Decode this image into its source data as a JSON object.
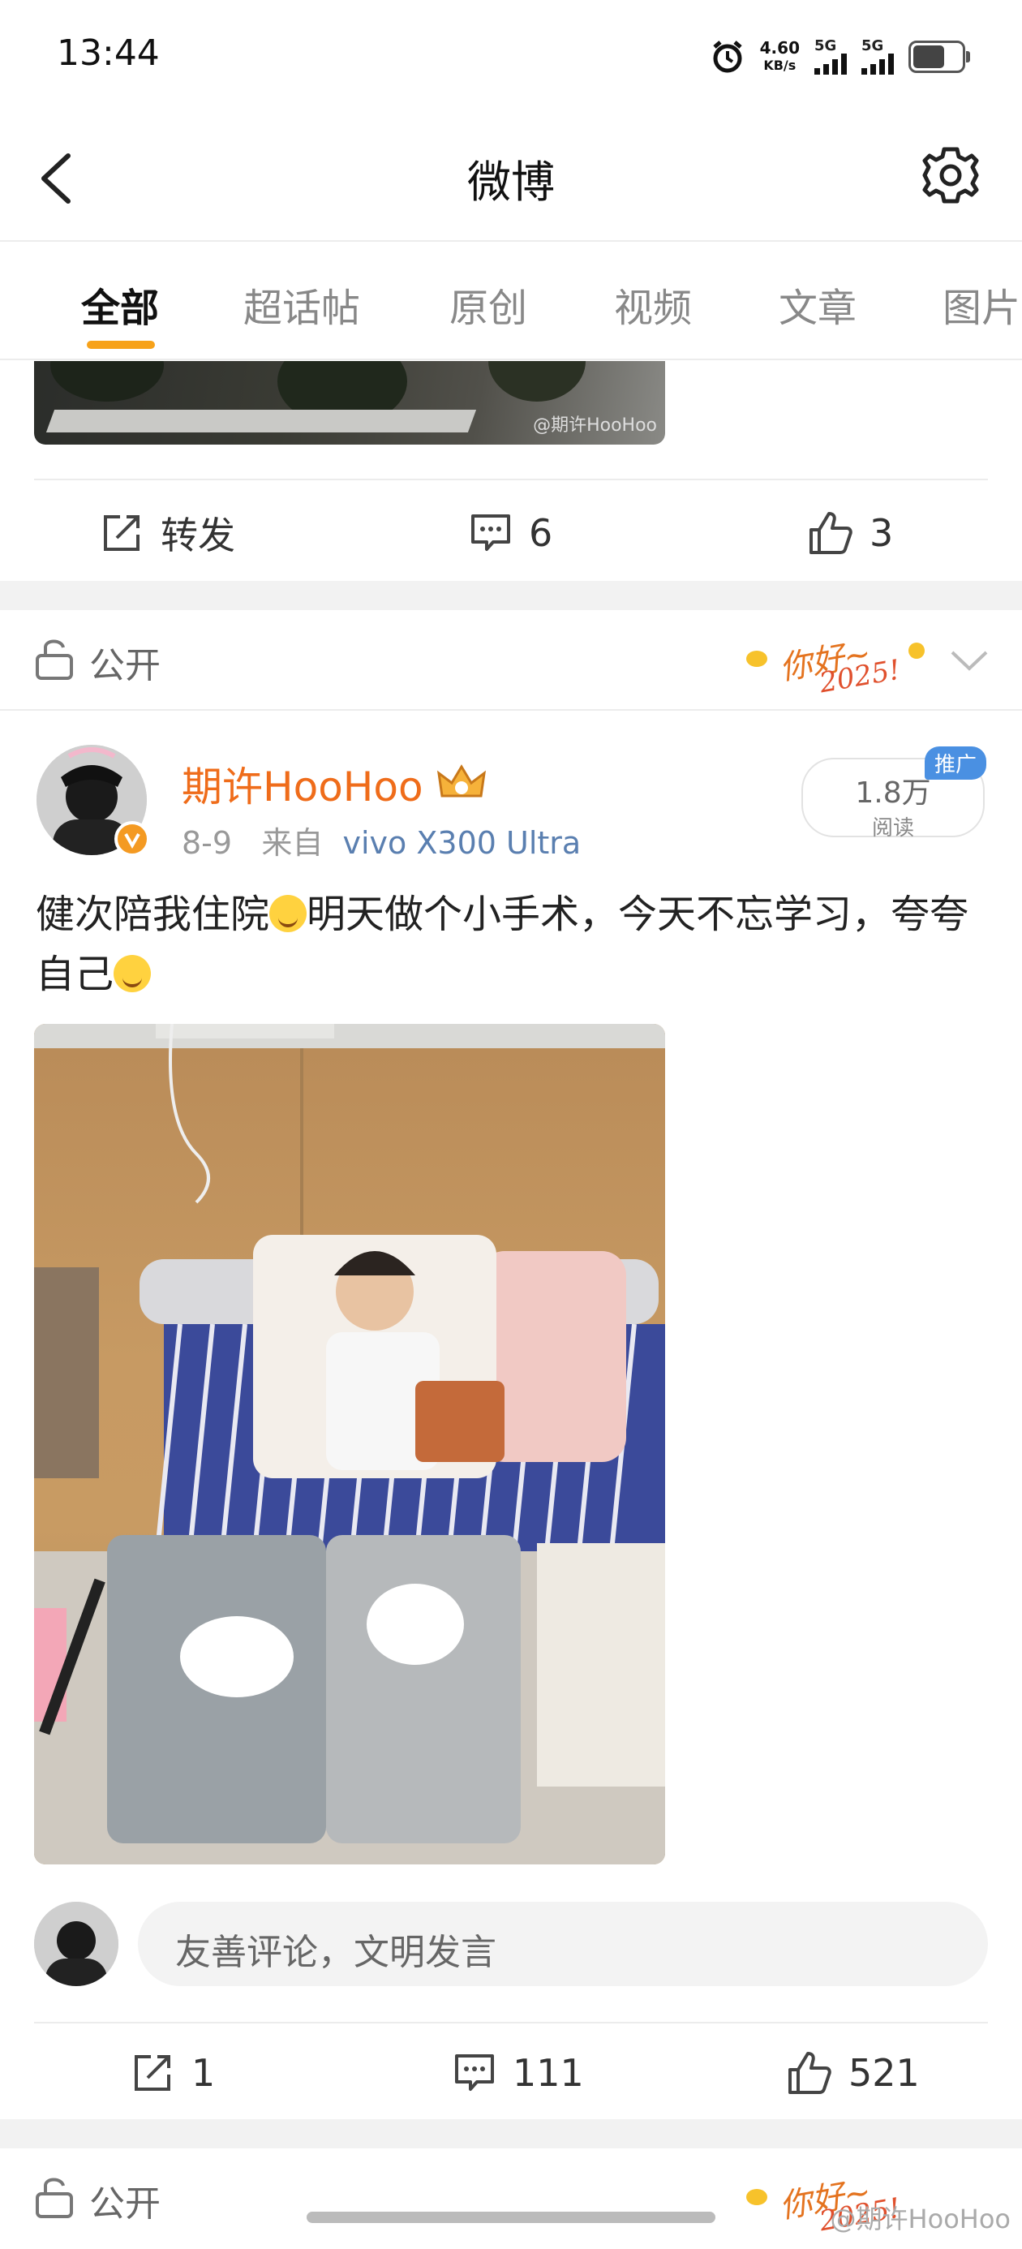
{
  "status_bar": {
    "time": "13:44",
    "net_speed_value": "4.60",
    "net_speed_unit": "KB/s",
    "signal1_label": "5G",
    "signal2_label": "5G"
  },
  "header": {
    "title": "微博"
  },
  "tabs": [
    {
      "label": "全部",
      "active": true
    },
    {
      "label": "超话帖",
      "active": false
    },
    {
      "label": "原创",
      "active": false
    },
    {
      "label": "视频",
      "active": false
    },
    {
      "label": "文章",
      "active": false
    },
    {
      "label": "图片",
      "active": false
    }
  ],
  "prev_post": {
    "watermark": "@期许HooHoo",
    "repost_label": "转发",
    "comment_count": "6",
    "like_count": "3"
  },
  "visibility": {
    "label": "公开",
    "badge_text": "你好~",
    "badge_year": "2025!"
  },
  "post": {
    "username": "期许HooHoo",
    "date": "8-9",
    "source_prefix": "来自",
    "source_device": "vivo X300 Ultra",
    "read_count": "1.8万",
    "read_label": "阅读",
    "promo_badge": "推广",
    "text_part1": "健次陪我住院",
    "text_part2": "明天做个小手术，今天不忘学习，夸夸自己",
    "repost_count": "1",
    "comment_count": "111",
    "like_count": "521"
  },
  "comment_box": {
    "placeholder": "友善评论，文明发言"
  },
  "next_post": {
    "visibility_label": "公开"
  },
  "bottom_watermark": "@期许HooHoo",
  "colors": {
    "accent": "#f7a21a",
    "username": "#ef6c1a",
    "source": "#5a7fb0",
    "promo": "#4a90e2"
  }
}
